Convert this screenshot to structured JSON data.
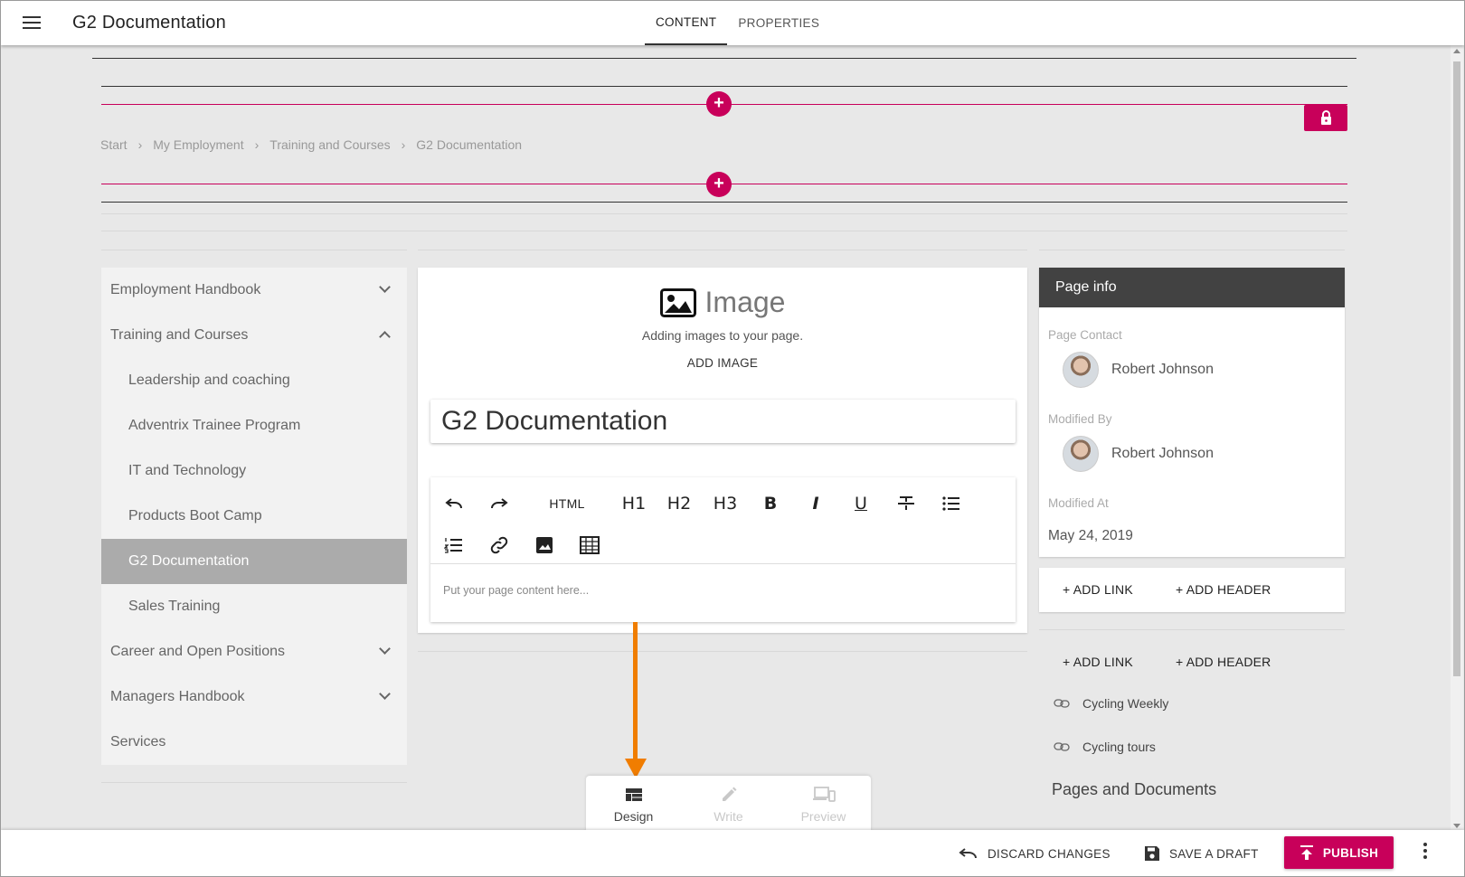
{
  "app": {
    "title": "G2 Documentation"
  },
  "top_tabs": [
    {
      "label": "CONTENT",
      "active": true
    },
    {
      "label": "PROPERTIES",
      "active": false
    }
  ],
  "breadcrumb": [
    "Start",
    "My Employment",
    "Training and Courses",
    "G2 Documentation"
  ],
  "sidenav": {
    "items": [
      {
        "label": "Employment Handbook",
        "level": 0,
        "expand": "down"
      },
      {
        "label": "Training and Courses",
        "level": 0,
        "expand": "up"
      },
      {
        "label": "Leadership and coaching",
        "level": 1
      },
      {
        "label": "Adventrix Trainee Program",
        "level": 1
      },
      {
        "label": "IT and Technology",
        "level": 1
      },
      {
        "label": "Products Boot Camp",
        "level": 1
      },
      {
        "label": "G2 Documentation",
        "level": 1,
        "active": true
      },
      {
        "label": "Sales Training",
        "level": 1
      },
      {
        "label": "Career and Open Positions",
        "level": 0,
        "expand": "down"
      },
      {
        "label": "Managers Handbook",
        "level": 0,
        "expand": "down"
      },
      {
        "label": "Services",
        "level": 0
      }
    ]
  },
  "editor": {
    "image_block": {
      "title": "Image",
      "subtitle": "Adding images to your page.",
      "action": "ADD IMAGE"
    },
    "page_title": "G2 Documentation",
    "toolbar": {
      "html": "HTML",
      "h1": "H1",
      "h2": "H2",
      "h3": "H3",
      "bold": "B",
      "italic": "I",
      "underline": "U"
    },
    "placeholder": "Put your page content here..."
  },
  "modes": [
    {
      "label": "Design",
      "icon": "design-icon",
      "enabled": true
    },
    {
      "label": "Write",
      "icon": "pencil-icon",
      "enabled": false
    },
    {
      "label": "Preview",
      "icon": "devices-icon",
      "enabled": false
    }
  ],
  "page_info": {
    "header": "Page info",
    "contact_label": "Page Contact",
    "contact_name": "Robert Johnson",
    "modified_by_label": "Modified By",
    "modified_by_name": "Robert Johnson",
    "modified_at_label": "Modified At",
    "modified_at": "May 24, 2019"
  },
  "links": {
    "add_link": "+ ADD LINK",
    "add_header": "+ ADD HEADER",
    "items": [
      "Cycling Weekly",
      "Cycling tours"
    ]
  },
  "pages_docs_heading": "Pages and Documents",
  "bottom": {
    "discard": "DISCARD CHANGES",
    "save_draft": "SAVE A DRAFT",
    "publish": "PUBLISH"
  },
  "colors": {
    "accent": "#c8005a",
    "arrow": "#f07d00",
    "header_dark": "#424242"
  }
}
